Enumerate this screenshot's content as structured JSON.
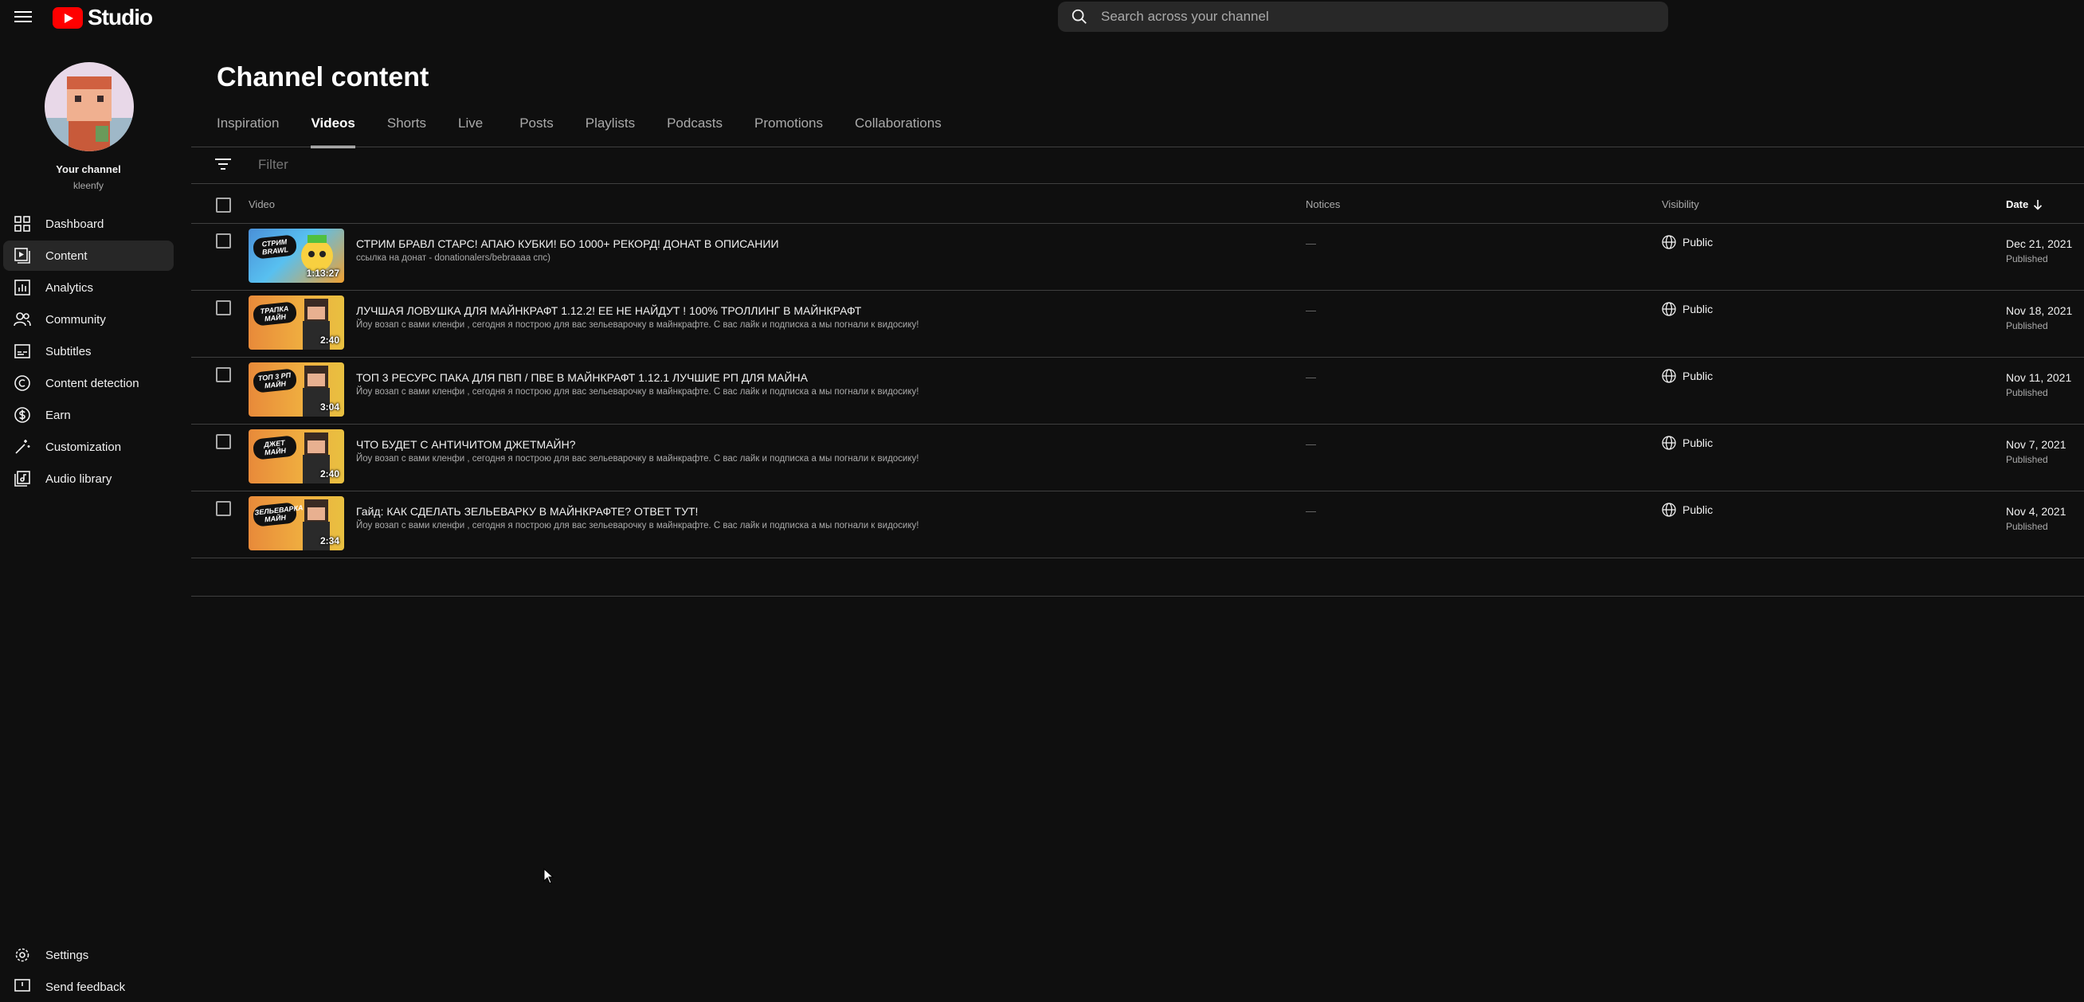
{
  "header": {
    "logo_text": "Studio",
    "search_placeholder": "Search across your channel"
  },
  "sidebar": {
    "channel_label": "Your channel",
    "channel_handle": "kleenfy",
    "items": [
      {
        "label": "Dashboard",
        "icon": "dashboard-icon"
      },
      {
        "label": "Content",
        "icon": "content-icon",
        "active": true
      },
      {
        "label": "Analytics",
        "icon": "analytics-icon"
      },
      {
        "label": "Community",
        "icon": "community-icon"
      },
      {
        "label": "Subtitles",
        "icon": "subtitles-icon"
      },
      {
        "label": "Content detection",
        "icon": "copyright-icon"
      },
      {
        "label": "Earn",
        "icon": "dollar-icon"
      },
      {
        "label": "Customization",
        "icon": "magic-wand-icon"
      },
      {
        "label": "Audio library",
        "icon": "audio-library-icon"
      }
    ],
    "bottom": [
      {
        "label": "Settings",
        "icon": "gear-icon"
      },
      {
        "label": "Send feedback",
        "icon": "feedback-icon"
      }
    ]
  },
  "main": {
    "title": "Channel content",
    "tabs": [
      "Inspiration",
      "Videos",
      "Shorts",
      "Live",
      "Posts",
      "Playlists",
      "Podcasts",
      "Promotions",
      "Collaborations"
    ],
    "active_tab": "Videos",
    "filter_placeholder": "Filter",
    "columns": {
      "video": "Video",
      "notices": "Notices",
      "visibility": "Visibility",
      "date": "Date"
    },
    "videos": [
      {
        "title": "СТРИМ БРАВЛ СТАРС! АПАЮ КУБКИ! БО 1000+ РЕКОРД! ДОНАТ В ОПИСАНИИ",
        "description": "ссылка на донат - donationalers/bebraaaa спс)",
        "duration": "1:13:27",
        "thumb_tag": "СТРИМ BRAWL",
        "notice": "—",
        "visibility": "Public",
        "date": "Dec 21, 2021",
        "status": "Published"
      },
      {
        "title": "ЛУЧШАЯ ЛОВУШКА ДЛЯ МАЙНКРАФТ 1.12.2! ЕЕ НЕ НАЙДУТ ! 100% ТРОЛЛИНГ В МАЙНКРАФТ",
        "description": "Йоу возап с вами кленфи , сегодня я построю для вас зельеварочку в майнкрафте. С вас лайк и подписка а мы погнали к видосику!",
        "duration": "2:40",
        "thumb_tag": "ТРАПКА МАЙН",
        "notice": "—",
        "visibility": "Public",
        "date": "Nov 18, 2021",
        "status": "Published"
      },
      {
        "title": "ТОП 3 РЕСУРС ПАКА ДЛЯ ПВП / ПВЕ В МАЙНКРАФТ 1.12.1 ЛУЧШИЕ РП ДЛЯ МАЙНА",
        "description": "Йоу возап с вами кленфи , сегодня я построю для вас зельеварочку в майнкрафте. С вас лайк и подписка а мы погнали к видосику!",
        "duration": "3:04",
        "thumb_tag": "ТОП 3 РП МАЙН",
        "notice": "—",
        "visibility": "Public",
        "date": "Nov 11, 2021",
        "status": "Published"
      },
      {
        "title": "ЧТО БУДЕТ С АНТИЧИТОМ ДЖЕТМАЙН?",
        "description": "Йоу возап с вами кленфи , сегодня я построю для вас зельеварочку в майнкрафте. С вас лайк и подписка а мы погнали к видосику!",
        "duration": "2:40",
        "thumb_tag": "ДЖЕТ МАЙН",
        "notice": "—",
        "visibility": "Public",
        "date": "Nov 7, 2021",
        "status": "Published"
      },
      {
        "title": "Гайд: КАК СДЕЛАТЬ ЗЕЛЬЕВАРКУ В МАЙНКРАФТЕ? ОТВЕТ ТУТ!",
        "description": "Йоу возап с вами кленфи , сегодня я построю для вас зельеварочку в майнкрафте. С вас лайк и подписка а мы погнали к видосику!",
        "duration": "2:34",
        "thumb_tag": "ЗЕЛЬЕВАРКА МАЙН",
        "notice": "—",
        "visibility": "Public",
        "date": "Nov 4, 2021",
        "status": "Published"
      }
    ]
  }
}
